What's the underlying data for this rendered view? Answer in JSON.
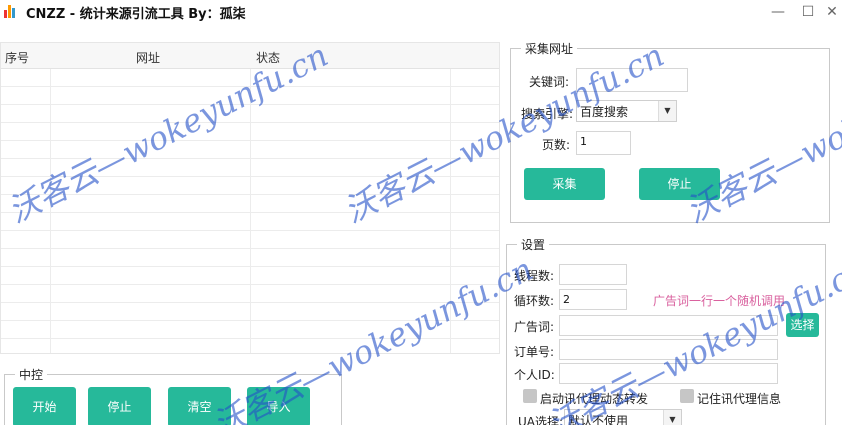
{
  "window": {
    "title": "CNZZ - 统计来源引流工具 By：孤柒",
    "minimize": "—",
    "maximize": "☐",
    "close": "✕"
  },
  "grid": {
    "columns": [
      "序号",
      "网址",
      "状态"
    ]
  },
  "control_group": {
    "title": "中控",
    "buttons": {
      "start": "开始",
      "stop": "停止",
      "clear": "清空",
      "import": "导入"
    }
  },
  "collect_group": {
    "title": "采集网址",
    "keyword_label": "关键词:",
    "keyword_value": "",
    "engine_label": "搜索引擎:",
    "engine_value": "百度搜索",
    "pages_label": "页数:",
    "pages_value": "1",
    "collect_button": "采集",
    "stop_button": "停止"
  },
  "settings_group": {
    "title": "设置",
    "threads_label": "线程数:",
    "threads_value": "",
    "loops_label": "循环数:",
    "loops_value": "2",
    "hint": "广告词一行一个随机调用",
    "ad_label": "广告词:",
    "ad_value": "",
    "select_button": "选择",
    "order_label": "订单号:",
    "order_value": "",
    "personal_label": "个人ID:",
    "personal_value": "",
    "proxy_checkbox": "启动讯代理动态转发",
    "remember_checkbox": "记住讯代理信息",
    "ua_label": "UA选择:",
    "ua_value": "默认不使用"
  },
  "watermark": "沃客云—wokeyunfu.cn",
  "colors": {
    "accent": "#26b99a",
    "hint": "#d9609e",
    "watermark": "#2350c8"
  }
}
